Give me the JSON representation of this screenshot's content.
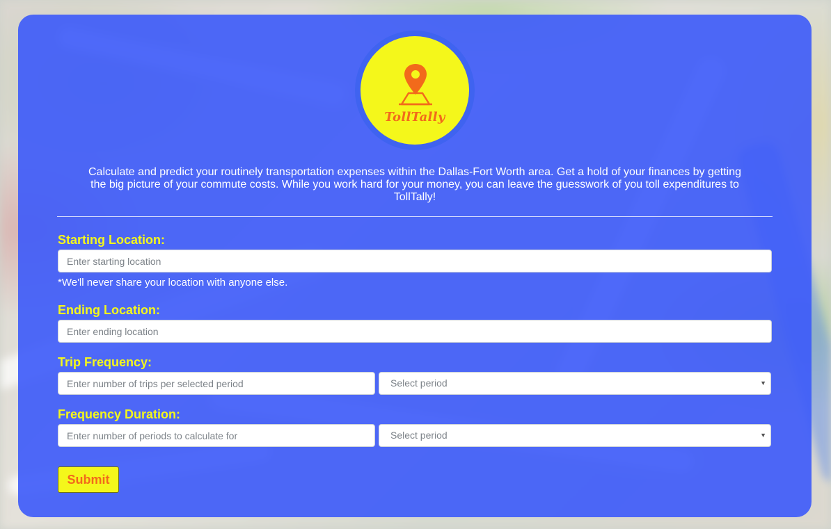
{
  "logo": {
    "text": "TollTally",
    "icon": "location-pin-icon"
  },
  "description": "Calculate and predict your routinely transportation expenses within the Dallas-Fort Worth area. Get a hold of your finances by getting the big picture of your commute costs. While you work hard for your money, you can leave the guesswork of you toll expenditures to TollTally!",
  "form": {
    "starting_location": {
      "label": "Starting Location:",
      "placeholder": "Enter starting location",
      "hint": "*We'll never share your location with anyone else."
    },
    "ending_location": {
      "label": "Ending Location:",
      "placeholder": "Enter ending location"
    },
    "trip_frequency": {
      "label": "Trip Frequency:",
      "placeholder": "Enter number of trips per selected period",
      "select_value": "Select period"
    },
    "frequency_duration": {
      "label": "Frequency Duration:",
      "placeholder": "Enter number of periods to calculate for",
      "select_value": "Select period"
    },
    "submit_label": "Submit"
  },
  "colors": {
    "card_background": "#3c5afa",
    "label_yellow": "#f4f71b",
    "logo_orange": "#f26a1b"
  }
}
